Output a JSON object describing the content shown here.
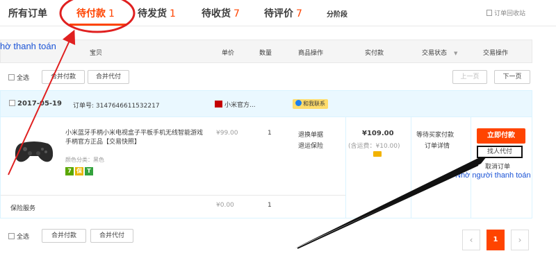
{
  "tabs": {
    "all": "所有订单",
    "pending_pay": "待付款",
    "pending_pay_count": "1",
    "pending_ship": "待发货",
    "pending_ship_count": "1",
    "pending_receive": "待收货",
    "pending_receive_count": "7",
    "pending_review": "待评价",
    "pending_review_count": "7",
    "installment": "分阶段",
    "recycle_bin": "订单回收站"
  },
  "annotations": {
    "self_pay": "hờ thanh toán",
    "proxy_pay": "Nhờ người thanh toán"
  },
  "table_header": {
    "item": "宝贝",
    "unit_price": "单价",
    "quantity": "数量",
    "item_ops": "商品操作",
    "paid": "实付款",
    "trade_status": "交易状态",
    "trade_ops": "交易操作"
  },
  "toolbar": {
    "select_all": "全选",
    "merge_pay": "合并付款",
    "merge_proxy": "合并代付",
    "prev_page": "上一页",
    "next_page": "下一页"
  },
  "order": {
    "date": "2017-05-19",
    "order_no_label": "订单号:",
    "order_no": "3147646611532217",
    "shop_name": "小米官方...",
    "chat_label": "和我联系",
    "product_title": "小米蓝牙手柄小米电视盒子平板手机无线智能游戏手柄官方正品【交易快照】",
    "product_variant": "颜色分类：黑色",
    "badges": [
      "7",
      "保",
      "T"
    ],
    "unit_price": "¥99.00",
    "quantity": "1",
    "ops_1": "退换单据",
    "ops_2": "退运保险",
    "total": "¥109.00",
    "shipping_note": "(含运费：¥10.00)",
    "status_1": "等待买家付款",
    "status_2": "订单详情",
    "pay_now": "立即付款",
    "find_proxy": "找人代付",
    "cancel": "取消订单",
    "service_name": "保险服务",
    "service_price": "¥0.00",
    "service_qty": "1"
  },
  "pager": {
    "prev": "‹",
    "current": "1",
    "next": "›"
  },
  "colors": {
    "accent": "#ff4400",
    "annotation_red": "#e02020",
    "annotation_blue": "#1a53d6"
  }
}
